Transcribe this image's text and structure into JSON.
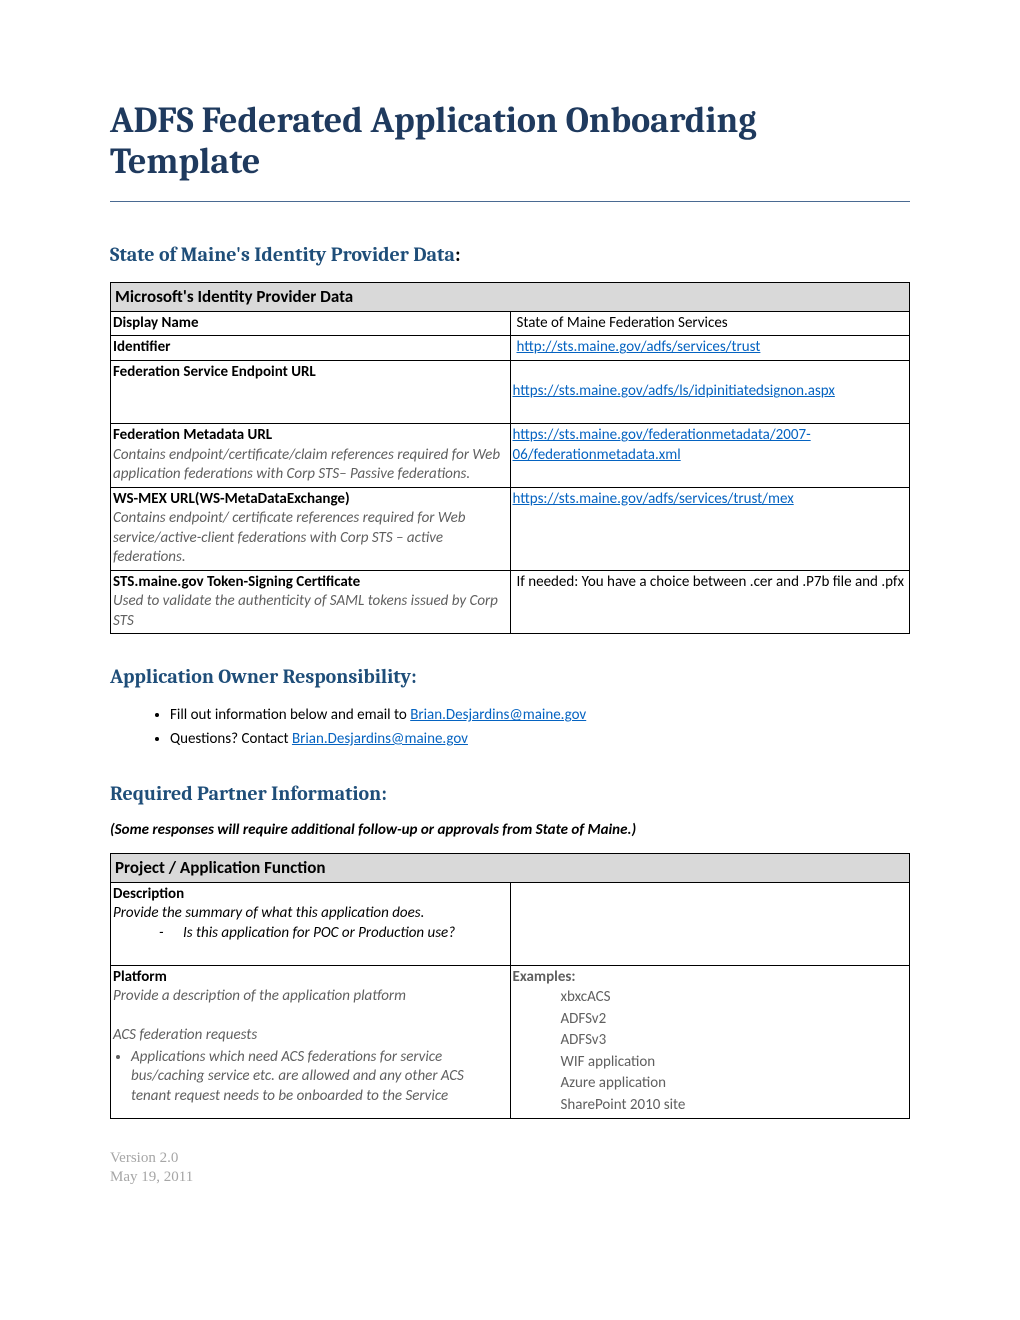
{
  "title": "ADFS Federated Application Onboarding Template",
  "section1": {
    "heading": "State of Maine's Identity Provider Data",
    "table_header": "Microsoft's Identity Provider Data",
    "rows": {
      "display_name": {
        "label": "Display Name",
        "value": "State of Maine Federation Services"
      },
      "identifier": {
        "label": "Identifier",
        "link": "http://sts.maine.gov/adfs/services/trust"
      },
      "endpoint": {
        "label": "Federation Service Endpoint URL",
        "link": "https://sts.maine.gov/adfs/ls/idpinitiatedsignon.aspx"
      },
      "metadata": {
        "label": "Federation Metadata URL",
        "desc": "Contains endpoint/certificate/claim references required for Web application federations with Corp STS– Passive federations.",
        "link": "https://sts.maine.gov/federationmetadata/2007-06/federationmetadata.xml"
      },
      "wsmex": {
        "label": "WS-MEX URL(WS-MetaDataExchange)",
        "desc": "Contains endpoint/ certificate references required for Web service/active-client federations with Corp STS – active federations.",
        "link": "https://sts.maine.gov/adfs/services/trust/mex"
      },
      "token": {
        "label": "STS.maine.gov Token-Signing Certificate",
        "desc": "Used to validate the authenticity of SAML tokens issued by Corp STS",
        "value": "If needed: You have a choice between .cer and .P7b file and .pfx"
      }
    }
  },
  "section2": {
    "heading": "Application Owner Responsibility:",
    "item1_pre": "Fill out information below and email to ",
    "item1_link": "Brian.Desjardins@maine.gov",
    "item2_pre": "Questions? Contact ",
    "item2_link": "Brian.Desjardins@maine.gov"
  },
  "section3": {
    "heading": "Required Partner Information:",
    "sub": "(Some responses will require additional follow-up or approvals from State of Maine.)",
    "table_header": "Project / Application Function",
    "desc": {
      "label": "Description",
      "hint": "Provide the summary of what this application does.",
      "q": "Is this application for POC or Production use?"
    },
    "platform": {
      "label": "Platform",
      "hint": "Provide a description of the application platform",
      "sub": "ACS federation requests",
      "bullet": "Applications which need ACS federations for service bus/caching service etc. are allowed and any other ACS tenant request needs to be onboarded to the Service",
      "examples_label": "Examples:",
      "examples": [
        "xbxcACS",
        "ADFSv2",
        "ADFSv3",
        "WIF application",
        "Azure application",
        "SharePoint 2010 site"
      ]
    }
  },
  "footer": {
    "version": "Version 2.0",
    "date": "May 19, 2011"
  }
}
